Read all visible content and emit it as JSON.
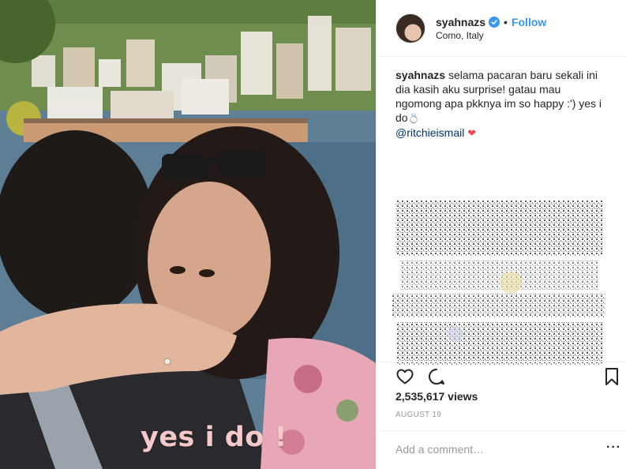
{
  "post": {
    "overlay_text": "yes i do !",
    "accent_color": "#3897f0"
  },
  "header": {
    "username": "syahnazs",
    "dot": "•",
    "follow_label": "Follow",
    "location": "Como, Italy"
  },
  "caption": {
    "username": "syahnazs",
    "text": "selama pacaran baru sekali ini dia kasih aku surprise! gatau mau ngomong apa pkknya im so happy :') yes i do",
    "ring_emoji": "💍",
    "mention": "@ritchieismail",
    "heart_emoji": "❤"
  },
  "actions": {
    "like_icon": "heart-outline-icon",
    "comment_icon": "comment-bubble-icon",
    "save_icon": "bookmark-icon"
  },
  "stats": {
    "views": "2,535,617 views",
    "date": "AUGUST 19"
  },
  "comment": {
    "placeholder": "Add a comment…",
    "more_label": "···"
  }
}
